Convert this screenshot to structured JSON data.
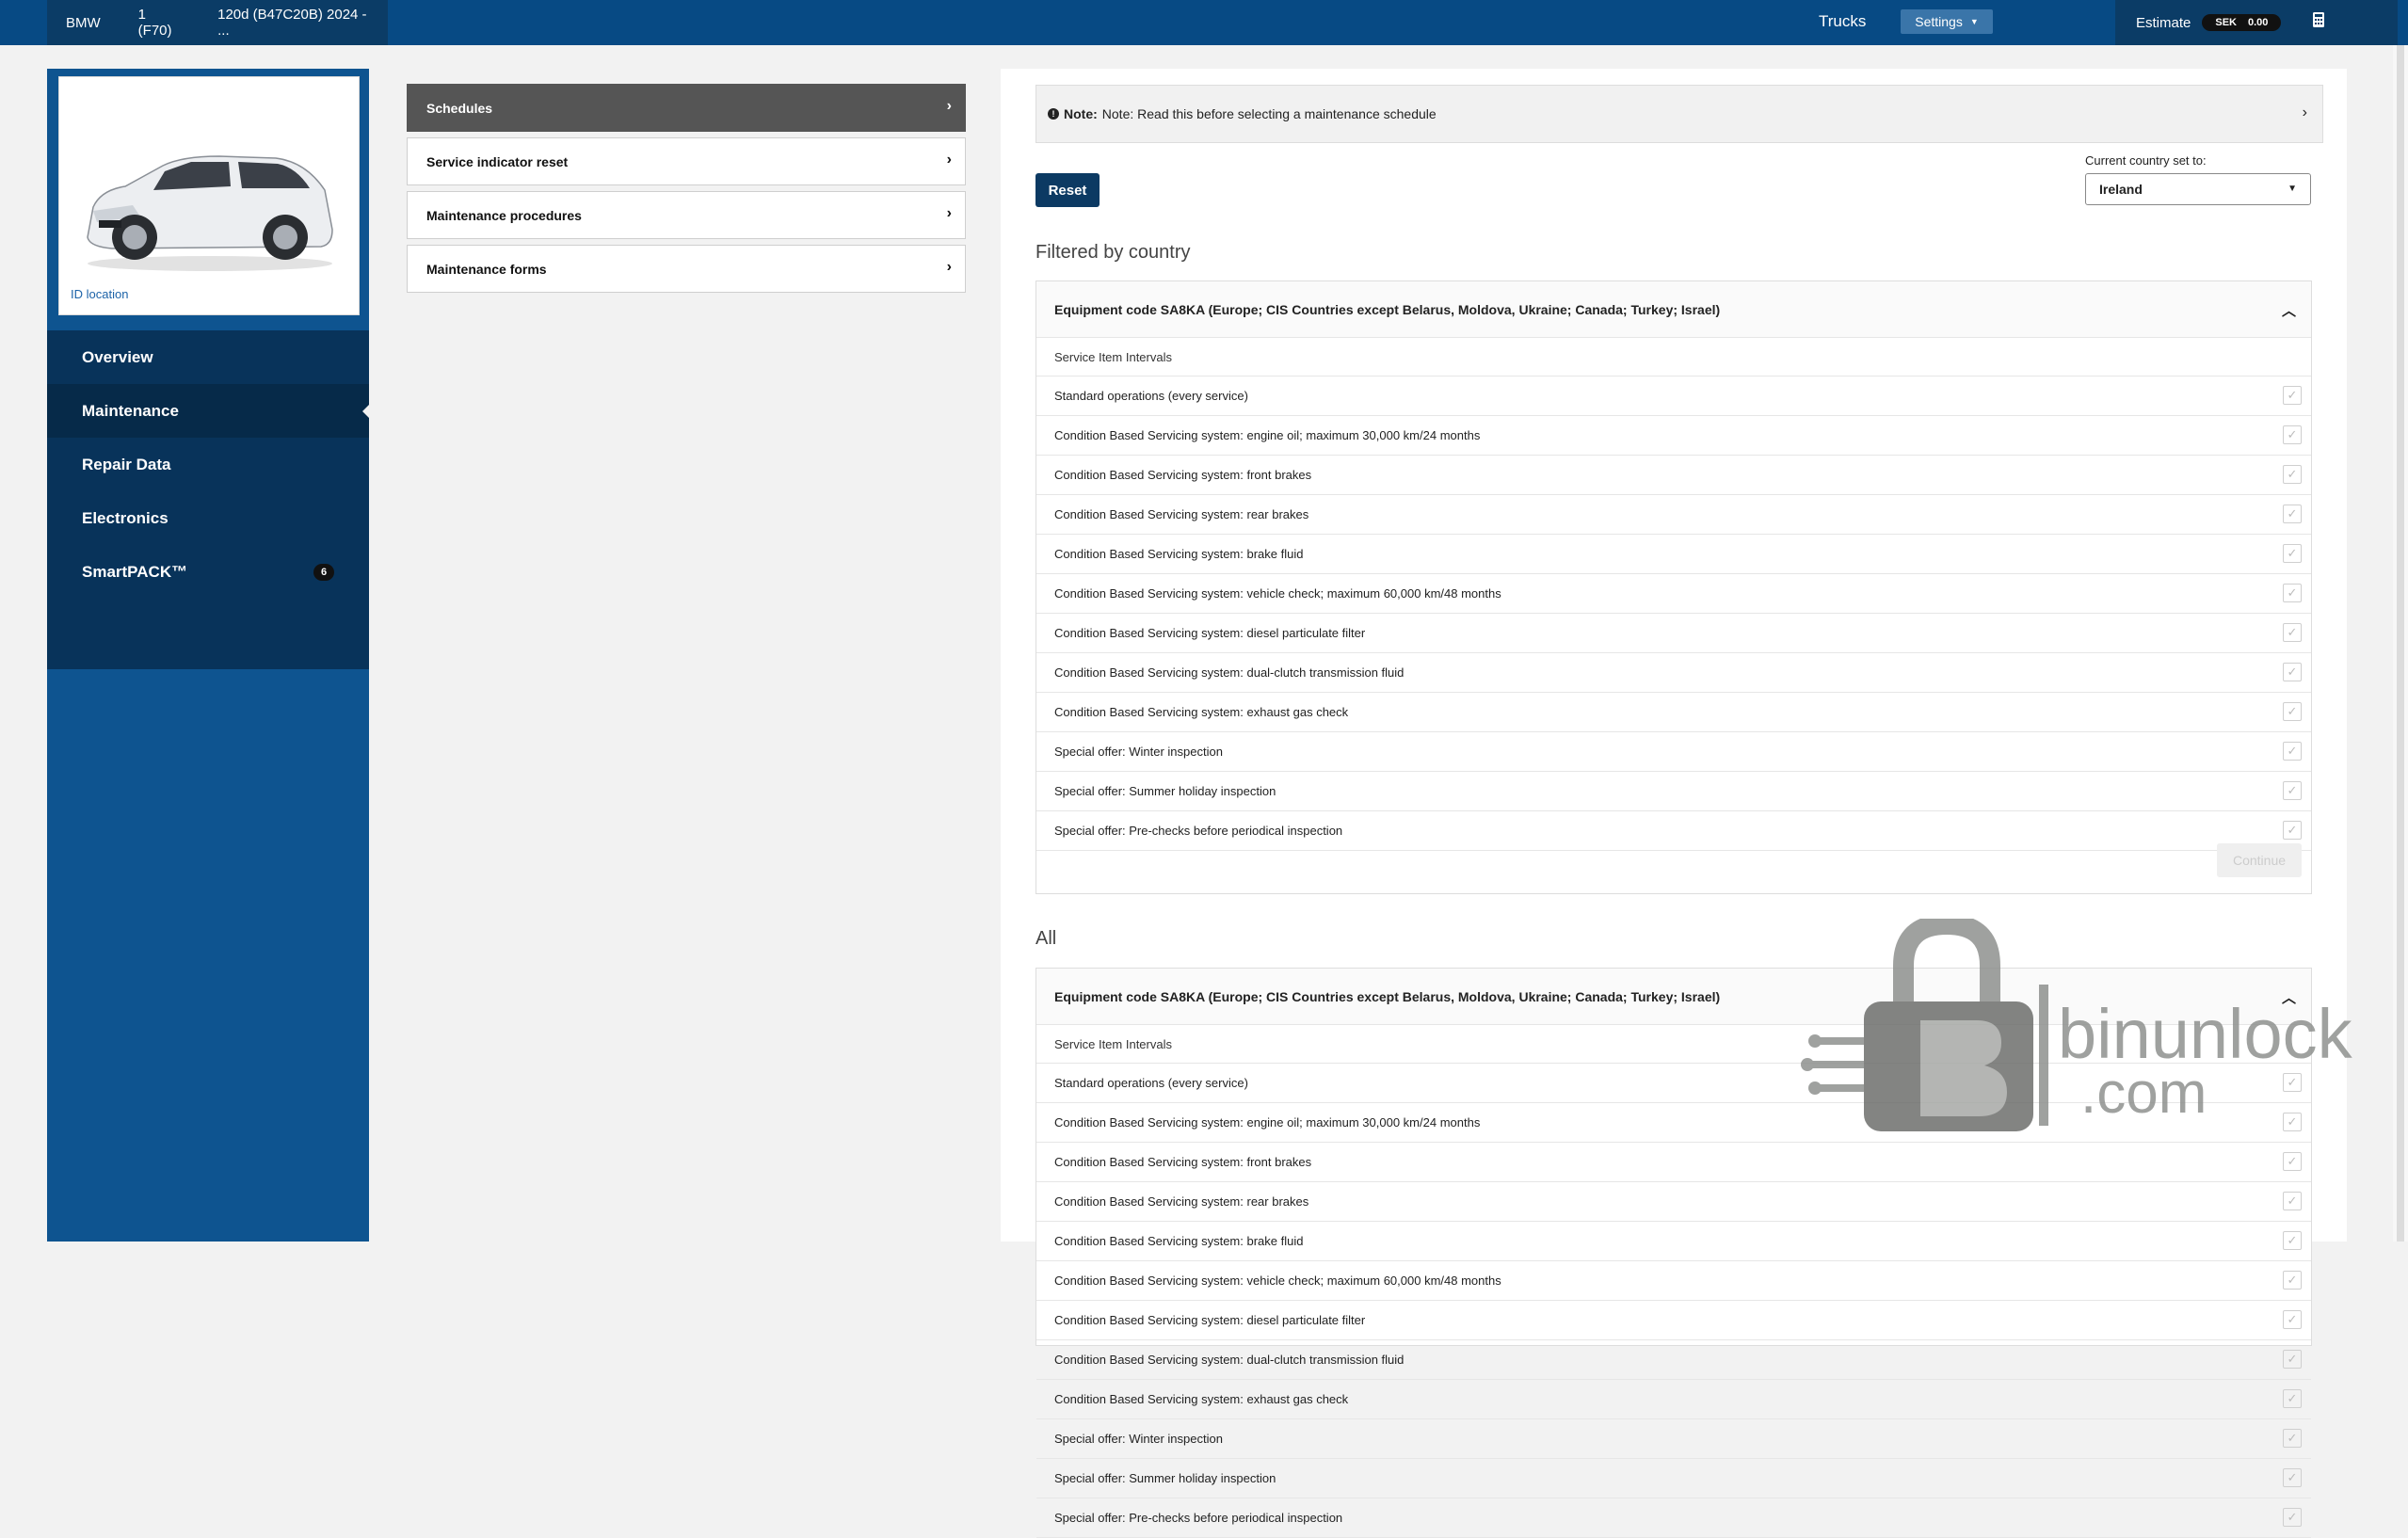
{
  "topbar": {
    "breadcrumbs": [
      "BMW",
      "1 (F70)",
      "120d (B47C20B) 2024 - ..."
    ],
    "trucks_label": "Trucks",
    "settings_label": "Settings",
    "estimate_label": "Estimate",
    "currency": "SEK",
    "estimate_value": "0.00"
  },
  "sidebar": {
    "id_location": "ID location",
    "nav": [
      {
        "label": "Overview"
      },
      {
        "label": "Maintenance"
      },
      {
        "label": "Repair Data"
      },
      {
        "label": "Electronics"
      },
      {
        "label": "SmartPACK™",
        "badge": "6"
      }
    ]
  },
  "menu": {
    "items": [
      {
        "label": "Schedules"
      },
      {
        "label": "Service indicator reset"
      },
      {
        "label": "Maintenance procedures"
      },
      {
        "label": "Maintenance forms"
      }
    ]
  },
  "main": {
    "note_bold": "Note:",
    "note_text": "Note: Read this before selecting a maintenance schedule",
    "reset_label": "Reset",
    "country_label": "Current country set to:",
    "country_value": "Ireland",
    "filtered_title": "Filtered by country",
    "all_title": "All",
    "equipment_title": "Equipment code SA8KA (Europe; CIS Countries except Belarus, Moldova, Ukraine; Canada; Turkey; Israel)",
    "service_item_intervals": "Service Item Intervals",
    "continue_label": "Continue",
    "rows": [
      "Standard operations (every service)",
      "Condition Based Servicing system: engine oil; maximum 30,000 km/24 months",
      "Condition Based Servicing system: front brakes",
      "Condition Based Servicing system: rear brakes",
      "Condition Based Servicing system: brake fluid",
      "Condition Based Servicing system: vehicle check; maximum 60,000 km/48 months",
      "Condition Based Servicing system: diesel particulate filter",
      "Condition Based Servicing system: dual-clutch transmission fluid",
      "Condition Based Servicing system: exhaust gas check",
      "Special offer: Winter inspection",
      "Special offer: Summer holiday inspection",
      "Special offer: Pre-checks before periodical inspection"
    ]
  },
  "watermark": {
    "text_top": "binunlock",
    "text_bottom": ".com"
  },
  "colors": {
    "topbar": "#074a84",
    "sidebar": "#0e5490",
    "nav": "#08335a",
    "reset": "#0c3a63"
  }
}
